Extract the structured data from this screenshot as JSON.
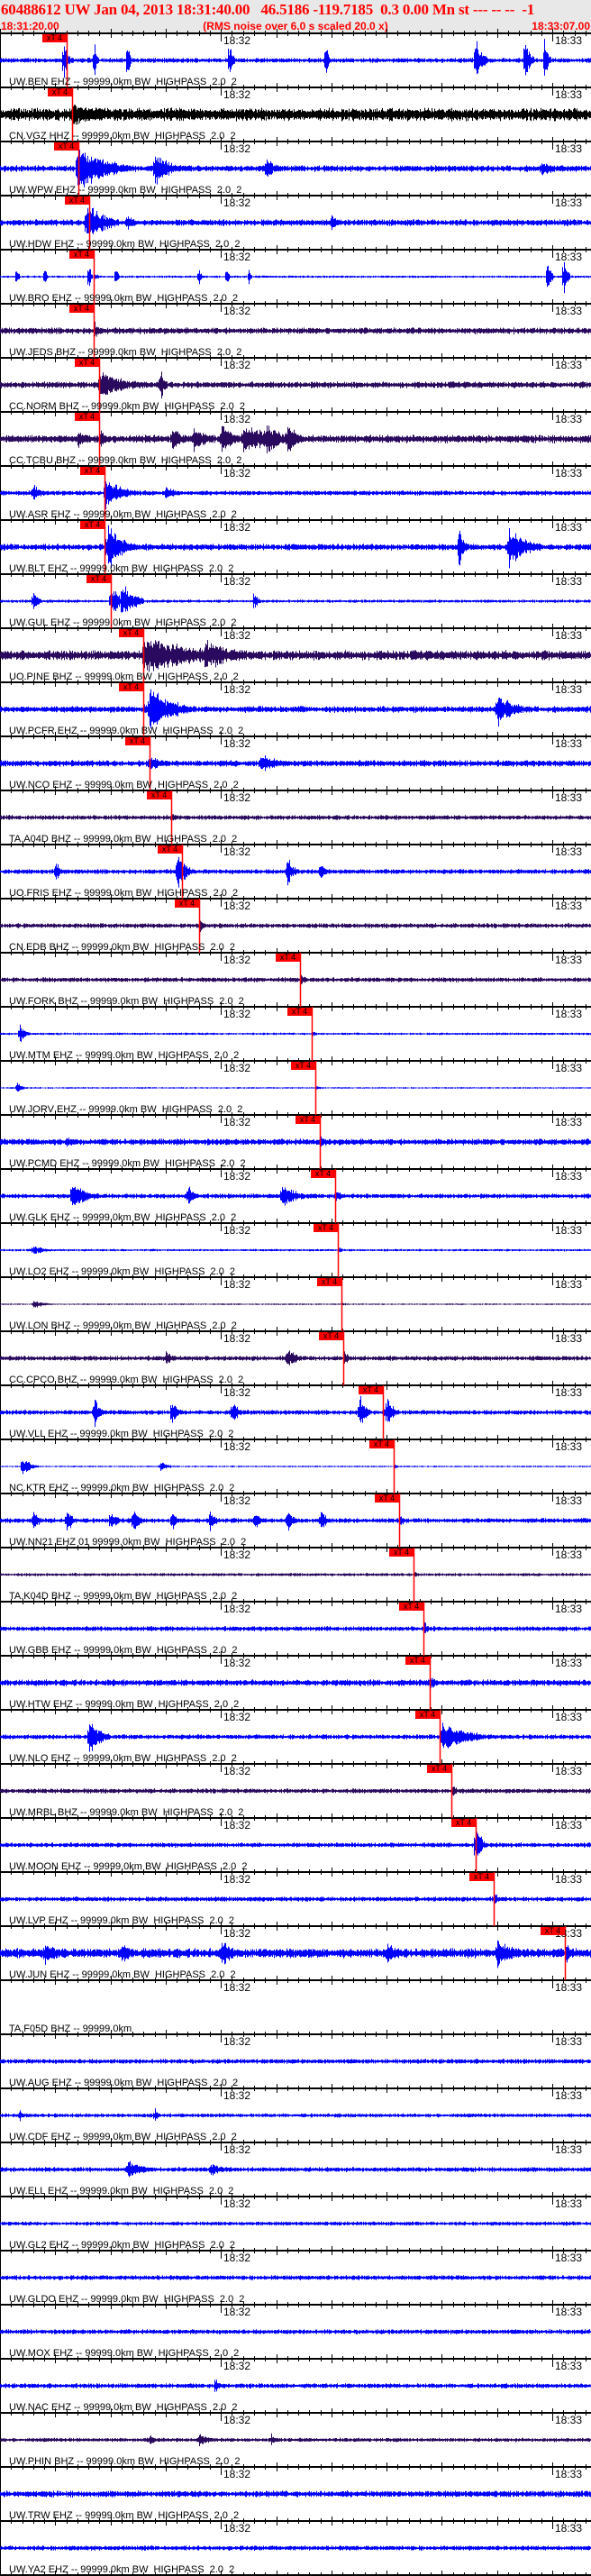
{
  "header": {
    "title": "60488612 UW Jan 04, 2013 18:31:40.00   46.5186 -119.7185  0.3 0.00 Mn st --- -- --  -1",
    "start_time": "18:31:20.00",
    "note": "(RMS noise over 6.0 s scaled 20.0 x)",
    "end_time": "18:33:07.00"
  },
  "chart_data": {
    "type": "line",
    "title": "60488612 UW Jan 04, 2013 18:31:40.00",
    "x_unit": "seconds after 18:31:20.00",
    "xlim": [
      0,
      107
    ],
    "tick_labels": [
      {
        "t": 40,
        "label": "18:32"
      },
      {
        "t": 100,
        "label": "18:33"
      }
    ],
    "pick_label": "xT 4",
    "colors": {
      "blue": "#0000ff",
      "purple": "#2a0a5e",
      "black": "#000000",
      "pick": "#ff0000"
    },
    "series": [
      {
        "name": "UW.BEN EHZ -- 99999.0km BW  HIGHPASS  2.0  2",
        "color": "blue",
        "noise": 3,
        "pick_s": 12.1,
        "events": [
          [
            11.5,
            30,
            0.5
          ],
          [
            17,
            30,
            0.4
          ],
          [
            23,
            30,
            0.4
          ],
          [
            41.5,
            30,
            0.5
          ],
          [
            59,
            28,
            0.4
          ],
          [
            86,
            30,
            1.2
          ],
          [
            95,
            30,
            0.8
          ],
          [
            98.5,
            30,
            0.6
          ]
        ]
      },
      {
        "name": "CN.VGZ HHZ -- 99999.0km BW  HIGHPASS  2.0  2",
        "color": "black",
        "noise": 8,
        "pick_s": 13.0,
        "events": [
          [
            13,
            14,
            6
          ]
        ]
      },
      {
        "name": "UW.WPW EHZ -- 99999.0km BW  HIGHPASS  2.0  2",
        "color": "blue",
        "noise": 4,
        "pick_s": 14.2,
        "events": [
          [
            14,
            30,
            5
          ],
          [
            28,
            20,
            3
          ],
          [
            48,
            14,
            2
          ],
          [
            98,
            12,
            2
          ]
        ]
      },
      {
        "name": "UW.HDW EHZ -- 99999.0km BW  HIGHPASS  2.0  2",
        "color": "blue",
        "noise": 4,
        "pick_s": 16.1,
        "events": [
          [
            15.5,
            30,
            3
          ],
          [
            23,
            14,
            1
          ],
          [
            60,
            10,
            1
          ]
        ]
      },
      {
        "name": "UW.BRO EHZ -- 99999.0km BW  HIGHPASS  2.0  2",
        "color": "blue",
        "noise": 1.5,
        "pick_s": 17.0,
        "events": [
          [
            3,
            14,
            0.3
          ],
          [
            8,
            18,
            0.3
          ],
          [
            16,
            20,
            0.4
          ],
          [
            21,
            16,
            0.3
          ],
          [
            36,
            14,
            0.3
          ],
          [
            41,
            16,
            0.3
          ],
          [
            45,
            14,
            0.3
          ],
          [
            99,
            28,
            0.6
          ],
          [
            102,
            26,
            0.6
          ]
        ]
      },
      {
        "name": "UW.JEDS BHZ -- 99999.0km BW  HIGHPASS  2.0  2",
        "color": "purple",
        "noise": 4,
        "pick_s": 17.0,
        "events": []
      },
      {
        "name": "CC.NORM BHZ -- 99999.0km BW  HIGHPASS  2.0  2",
        "color": "purple",
        "noise": 4,
        "pick_s": 17.9,
        "events": [
          [
            18,
            18,
            5
          ],
          [
            29,
            24,
            0.6
          ]
        ]
      },
      {
        "name": "CC.TCBU BHZ -- 99999.0km BW  HIGHPASS  2.0  2",
        "color": "purple",
        "noise": 5,
        "pick_s": 17.9,
        "events": [
          [
            14,
            12,
            2
          ],
          [
            31,
            16,
            2
          ],
          [
            35,
            20,
            2
          ],
          [
            40,
            22,
            2
          ],
          [
            44,
            22,
            4
          ],
          [
            48,
            22,
            3
          ],
          [
            52,
            20,
            2
          ]
        ]
      },
      {
        "name": "UW.ASR EHZ -- 99999.0km BW  HIGHPASS  2.0  2",
        "color": "blue",
        "noise": 3,
        "pick_s": 18.9,
        "events": [
          [
            6,
            12,
            1.5
          ],
          [
            19,
            22,
            3
          ],
          [
            30,
            10,
            2
          ]
        ]
      },
      {
        "name": "UW.BLT EHZ -- 99999.0km BW  HIGHPASS  2.0  2",
        "color": "blue",
        "noise": 4,
        "pick_s": 18.9,
        "events": [
          [
            19.5,
            30,
            2.5
          ],
          [
            83,
            30,
            0.8
          ],
          [
            92,
            30,
            3
          ]
        ]
      },
      {
        "name": "UW.GUL EHZ -- 99999.0km BW  HIGHPASS  2.0  2",
        "color": "blue",
        "noise": 2,
        "pick_s": 20.1,
        "events": [
          [
            6,
            18,
            0.8
          ],
          [
            20,
            22,
            1.5
          ],
          [
            22,
            26,
            2
          ],
          [
            46,
            18,
            0.5
          ]
        ]
      },
      {
        "name": "UO.PINE BHZ -- 99999.0km BW  HIGHPASS  2.0  2",
        "color": "purple",
        "noise": 6,
        "pick_s": 25.9,
        "events": [
          [
            26,
            24,
            10
          ],
          [
            37,
            20,
            6
          ]
        ]
      },
      {
        "name": "UW.PCFR EHZ -- 99999.0km BW  HIGHPASS  2.0  2",
        "color": "blue",
        "noise": 4,
        "pick_s": 25.9,
        "events": [
          [
            27,
            30,
            4
          ],
          [
            90,
            22,
            3
          ]
        ]
      },
      {
        "name": "UW.NCO EHZ -- 99999.0km BW  HIGHPASS  2.0  2",
        "color": "blue",
        "noise": 4,
        "pick_s": 27.1,
        "events": [
          [
            27,
            12,
            2
          ],
          [
            47,
            12,
            4
          ]
        ]
      },
      {
        "name": "TA.A04D BHZ -- 99999.0km BW  HIGHPASS  2.0  2",
        "color": "purple",
        "noise": 3,
        "pick_s": 31.0,
        "events": []
      },
      {
        "name": "UO.FRIS EHZ -- 99999.0km BW  HIGHPASS  2.0  2",
        "color": "blue",
        "noise": 3,
        "pick_s": 33.0,
        "events": [
          [
            10,
            14,
            1
          ],
          [
            32,
            26,
            1.5
          ],
          [
            52,
            20,
            1
          ],
          [
            58,
            14,
            1
          ]
        ]
      },
      {
        "name": "CN.EDB BHZ -- 99999.0km BW  HIGHPASS  2.0  2",
        "color": "purple",
        "noise": 3,
        "pick_s": 36.1,
        "events": []
      },
      {
        "name": "UW.FORK BHZ -- 99999.0km BW  HIGHPASS  2.0  2",
        "color": "purple",
        "noise": 3,
        "pick_s": 54.3,
        "events": []
      },
      {
        "name": "UW.MTM EHZ -- 99999.0km BW  HIGHPASS  2.0  2",
        "color": "blue",
        "noise": 1.5,
        "pick_s": 56.4,
        "events": [
          [
            3.5,
            14,
            1
          ]
        ]
      },
      {
        "name": "UW.JORV EHZ -- 99999.0km BW  HIGHPASS  2.0  2",
        "color": "blue",
        "noise": 1,
        "pick_s": 57.1,
        "events": [
          [
            3,
            8,
            1
          ]
        ]
      },
      {
        "name": "UW.PCMD EHZ -- 99999.0km BW  HIGHPASS  2.0  2",
        "color": "blue",
        "noise": 4,
        "pick_s": 57.9,
        "events": [
          [
            12,
            8,
            2
          ]
        ]
      },
      {
        "name": "UW.GLK EHZ -- 99999.0km BW  HIGHPASS  2.0  2",
        "color": "blue",
        "noise": 3,
        "pick_s": 60.7,
        "events": [
          [
            13,
            16,
            3
          ],
          [
            34,
            18,
            1
          ],
          [
            51,
            14,
            3
          ]
        ]
      },
      {
        "name": "UW.LO2 EHZ -- 99999.0km BW  HIGHPASS  2.0  2",
        "color": "blue",
        "noise": 1.5,
        "pick_s": 61.2,
        "events": [
          [
            6,
            6,
            2
          ]
        ]
      },
      {
        "name": "UW.LON BHZ -- 99999.0km BW  HIGHPASS  2.0  2",
        "color": "purple",
        "noise": 1,
        "pick_s": 61.8,
        "events": [
          [
            6,
            5,
            2
          ]
        ]
      },
      {
        "name": "CC.CPCO BHZ -- 99999.0km BW  HIGHPASS  2.0  2",
        "color": "purple",
        "noise": 3,
        "pick_s": 62.2,
        "events": [
          [
            30,
            12,
            1
          ],
          [
            52,
            12,
            2
          ]
        ]
      },
      {
        "name": "UW.VLL EHZ -- 99999.0km BW  HIGHPASS  2.0  2",
        "color": "blue",
        "noise": 3,
        "pick_s": 69.3,
        "events": [
          [
            17,
            20,
            1
          ],
          [
            31,
            20,
            1
          ],
          [
            42,
            18,
            1
          ],
          [
            65,
            24,
            1
          ],
          [
            70,
            22,
            1
          ]
        ]
      },
      {
        "name": "NC.KTR EHZ -- 99999.0km BW  HIGHPASS  2.0  2",
        "color": "blue",
        "noise": 1,
        "pick_s": 71.3,
        "events": [
          [
            4,
            12,
            1.5
          ],
          [
            29,
            6,
            1.5
          ]
        ]
      },
      {
        "name": "UW.NN21 EHZ 01 99999.0km BW  HIGHPASS  2.0  2",
        "color": "blue",
        "noise": 3,
        "pick_s": 72.3,
        "events": [
          [
            6,
            14,
            1
          ],
          [
            12,
            18,
            1
          ],
          [
            20,
            14,
            1
          ],
          [
            24,
            18,
            1
          ],
          [
            31,
            14,
            1
          ],
          [
            38,
            16,
            1
          ],
          [
            46,
            14,
            1
          ],
          [
            52,
            16,
            1
          ],
          [
            58,
            14,
            1
          ]
        ]
      },
      {
        "name": "TA.K04D BHZ -- 99999.0km BW  HIGHPASS  2.0  2",
        "color": "purple",
        "noise": 2,
        "pick_s": 74.9,
        "events": []
      },
      {
        "name": "UW.GBB EHZ -- 99999.0km BW  HIGHPASS  2.0  2",
        "color": "blue",
        "noise": 3,
        "pick_s": 76.7,
        "events": []
      },
      {
        "name": "UW.HTW EHZ -- 99999.0km BW  HIGHPASS  2.0  2",
        "color": "blue",
        "noise": 4,
        "pick_s": 77.8,
        "events": []
      },
      {
        "name": "UW.NLO EHZ -- 99999.0km BW  HIGHPASS  2.0  2",
        "color": "blue",
        "noise": 3,
        "pick_s": 79.6,
        "events": [
          [
            16,
            26,
            2
          ],
          [
            80,
            18,
            5
          ]
        ]
      },
      {
        "name": "UW.MRBL BHZ -- 99999.0km BW  HIGHPASS  2.0  2",
        "color": "purple",
        "noise": 3,
        "pick_s": 81.7,
        "events": []
      },
      {
        "name": "UW.MOON EHZ -- 99999.0km BW  HIGHPASS  2.0  2",
        "color": "blue",
        "noise": 3,
        "pick_s": 86.1,
        "events": [
          [
            86,
            30,
            1
          ]
        ]
      },
      {
        "name": "UW.LVP EHZ -- 99999.0km BW  HIGHPASS  2.0  2",
        "color": "blue",
        "noise": 3,
        "pick_s": 89.4,
        "events": []
      },
      {
        "name": "UW.JUN EHZ -- 99999.0km BW  HIGHPASS  2.0  2",
        "color": "blue",
        "noise": 6,
        "pick_s": 102.3,
        "events": [
          [
            8,
            18,
            2
          ],
          [
            22,
            16,
            2
          ],
          [
            40,
            18,
            2
          ],
          [
            70,
            16,
            2
          ],
          [
            90,
            18,
            3
          ]
        ]
      },
      {
        "name": "TA.F05D BHZ -- 99999.0km",
        "color": "blue",
        "noise": 0,
        "pick_s": null,
        "events": []
      },
      {
        "name": "UW.AUG EHZ -- 99999.0km BW  HIGHPASS  2.0  2",
        "color": "blue",
        "noise": 3,
        "pick_s": null,
        "events": []
      },
      {
        "name": "UW.CDF EHZ -- 99999.0km BW  HIGHPASS  2.0  2",
        "color": "blue",
        "noise": 2.5,
        "pick_s": null,
        "events": [
          [
            3.5,
            10,
            0.5
          ],
          [
            28,
            10,
            0.5
          ]
        ]
      },
      {
        "name": "UW.ELL EHZ -- 99999.0km BW  HIGHPASS  2.0  2",
        "color": "blue",
        "noise": 3,
        "pick_s": null,
        "events": [
          [
            23,
            12,
            3
          ],
          [
            38,
            10,
            2
          ]
        ]
      },
      {
        "name": "UW.GL2 EHZ -- 99999.0km BW  HIGHPASS  2.0  2",
        "color": "blue",
        "noise": 2.5,
        "pick_s": null,
        "events": []
      },
      {
        "name": "UW.GLDO EHZ -- 99999.0km BW  HIGHPASS  2.0  2",
        "color": "blue",
        "noise": 3,
        "pick_s": null,
        "events": []
      },
      {
        "name": "UW.MOX EHZ -- 99999.0km BW  HIGHPASS  2.0  2",
        "color": "blue",
        "noise": 3,
        "pick_s": null,
        "events": []
      },
      {
        "name": "UW.NAC EHZ -- 99999.0km BW  HIGHPASS  2.0  2",
        "color": "blue",
        "noise": 3,
        "pick_s": null,
        "events": [
          [
            39,
            16,
            0.4
          ]
        ]
      },
      {
        "name": "UW.PHIN BHZ -- 99999.0km BW  HIGHPASS  2.0  2",
        "color": "purple",
        "noise": 2.5,
        "pick_s": null,
        "events": [
          [
            27,
            8,
            1
          ],
          [
            36,
            8,
            2
          ],
          [
            49,
            8,
            1
          ]
        ]
      },
      {
        "name": "UW.TRW EHZ -- 99999.0km BW  HIGHPASS  2.0  2",
        "color": "blue",
        "noise": 4,
        "pick_s": null,
        "events": []
      },
      {
        "name": "UW.YA2 EHZ -- 99999.0km BW  HIGHPASS  2.0  2",
        "color": "blue",
        "noise": 3,
        "pick_s": null,
        "events": []
      }
    ]
  }
}
